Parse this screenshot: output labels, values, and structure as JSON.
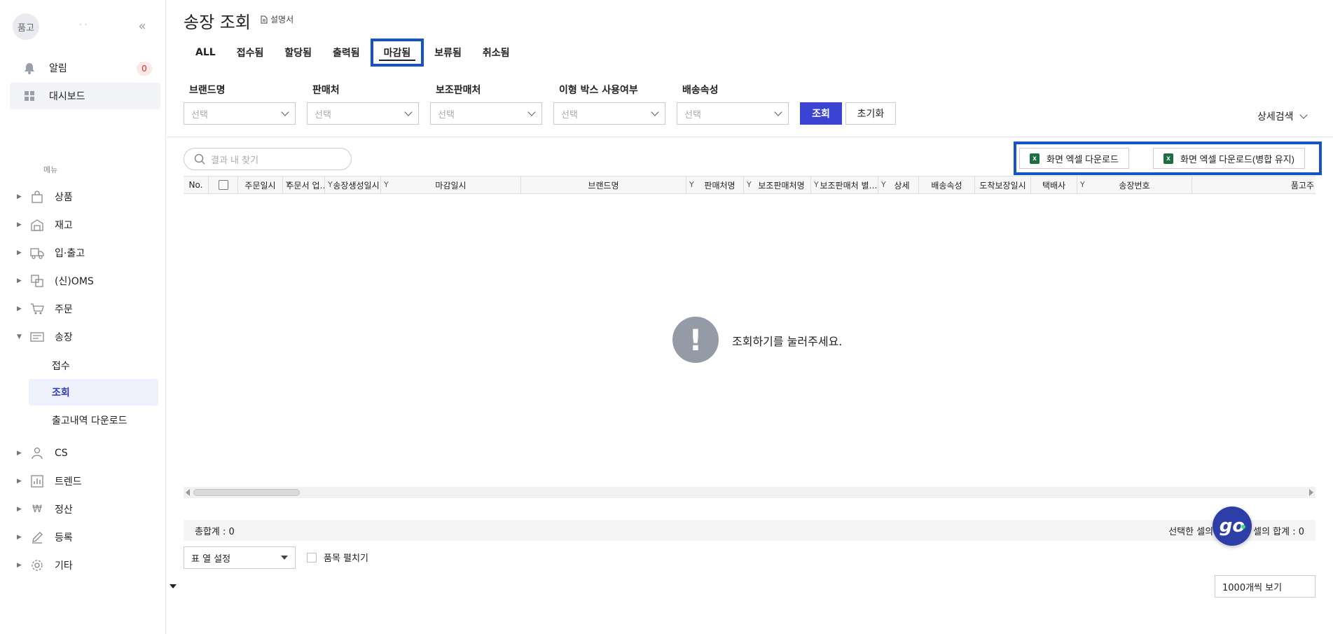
{
  "sidebar": {
    "avatar_text": "품고",
    "username": "· ·",
    "collapse_icon": "double-chevron-left-icon",
    "top_items": [
      {
        "label": "알림",
        "icon": "bell-icon",
        "badge": "0"
      },
      {
        "label": "대시보드",
        "icon": "dashboard-icon"
      }
    ],
    "menu_caption": "메뉴",
    "menu": [
      {
        "label": "상품",
        "icon": "bag-icon"
      },
      {
        "label": "재고",
        "icon": "warehouse-icon"
      },
      {
        "label": "입·출고",
        "icon": "truck-icon"
      },
      {
        "label": "(신)OMS",
        "icon": "oms-icon"
      },
      {
        "label": "주문",
        "icon": "cart-icon"
      },
      {
        "label": "송장",
        "icon": "invoice-icon",
        "expanded": true
      },
      {
        "label": "CS",
        "icon": "person-icon"
      },
      {
        "label": "트렌드",
        "icon": "chart-icon"
      },
      {
        "label": "정산",
        "icon": "won-icon"
      },
      {
        "label": "등록",
        "icon": "pencil-icon"
      },
      {
        "label": "기타",
        "icon": "gear-icon"
      }
    ],
    "submenu": [
      {
        "label": "접수"
      },
      {
        "label": "조회",
        "active": true
      },
      {
        "label": "출고내역 다운로드"
      }
    ]
  },
  "header": {
    "title": "송장 조회",
    "manual_label": "설명서"
  },
  "tabs": [
    "ALL",
    "접수됨",
    "할당됨",
    "출력됨",
    "마감됨",
    "보류됨",
    "취소됨"
  ],
  "active_tab": "마감됨",
  "filters": [
    {
      "label": "브랜드명",
      "placeholder": "선택"
    },
    {
      "label": "판매처",
      "placeholder": "선택"
    },
    {
      "label": "보조판매처",
      "placeholder": "선택"
    },
    {
      "label": "이형 박스 사용여부",
      "placeholder": "선택"
    },
    {
      "label": "배송속성",
      "placeholder": "선택"
    }
  ],
  "buttons": {
    "search": "조회",
    "reset": "초기화",
    "detail_search": "상세검색",
    "excel_download": "화면 엑셀 다운로드",
    "excel_download_merged": "화면 엑셀 다운로드(병합 유지)"
  },
  "find_placeholder": "결과 내 찾기",
  "grid": {
    "columns": [
      "No.",
      "",
      "주문일시",
      "주문서 업…",
      "송장생성일시",
      "마감일시",
      "브랜드명",
      "판매처명",
      "보조판매처명",
      "보조판매처 별…",
      "상세",
      "배송속성",
      "도착보장일시",
      "택배사",
      "송장번호",
      "품고주"
    ],
    "empty_message": "조회하기를 눌러주세요."
  },
  "footer": {
    "total": "총합계 : 0",
    "selected_count": "선택한 셀의 개수 : 0",
    "selected_sum": "셀의 합계 : 0",
    "column_settings": "표 열 설정",
    "expand_items": "품목 펼치기",
    "page_size": "1000개씩 보기"
  },
  "colors": {
    "accent": "#3a43d2",
    "highlight": "#1554c7",
    "active_sub_bg": "#eef1fb"
  }
}
